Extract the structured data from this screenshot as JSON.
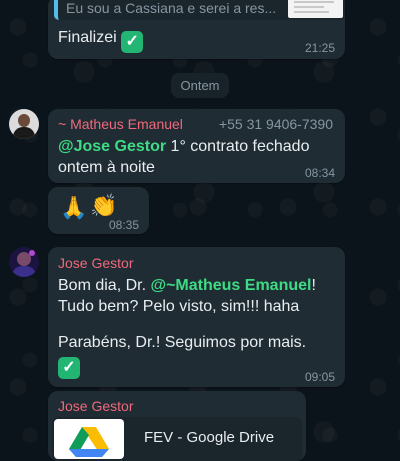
{
  "messages": {
    "top": {
      "quoted_text": "Eu sou a Cassiana e serei a res...",
      "text": "Finalizei",
      "time": "21:25"
    },
    "date_divider": "Ontem",
    "matheus": {
      "sender": "~ Matheus Emanuel",
      "phone": "+55 31 9406-7390",
      "mention": "@Jose Gestor",
      "text": " 1° contrato fechado ontem à noite",
      "time": "08:34"
    },
    "emoji": {
      "emoji_icons": [
        "folded-hands-icon",
        "clapping-hands-icon"
      ],
      "time": "08:35"
    },
    "jose": {
      "sender": "Jose Gestor",
      "text_before": "Bom dia, Dr. ",
      "mention": "@~Matheus Emanuel",
      "text_after": "! Tudo bem? Pelo visto, sim!!! haha",
      "text2": "Parabéns, Dr.! Seguimos por mais.",
      "time": "09:05"
    },
    "jose_doc": {
      "sender": "Jose Gestor",
      "doc_title": "FEV - Google Drive"
    }
  },
  "colors": {
    "background": "#0b141a",
    "bubble": "#1f2c34",
    "matheus_name": "#f0697a",
    "jose_name": "#f0697a",
    "mention": "#3ddc84",
    "check": "#22b573"
  }
}
